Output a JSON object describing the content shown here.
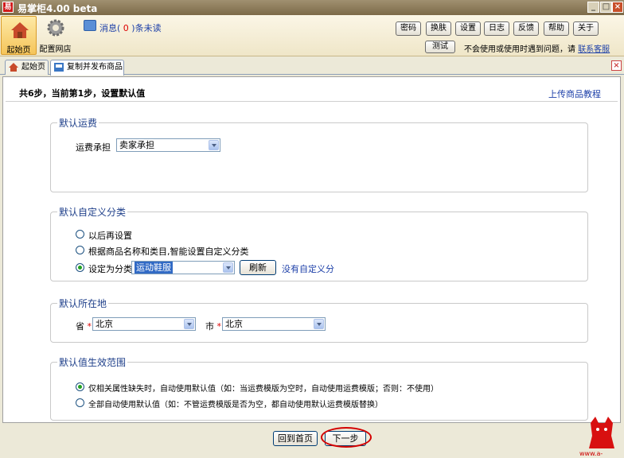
{
  "window": {
    "title": "易掌柜4.00 beta",
    "app_icon": "易"
  },
  "toolbar": {
    "home_label": "起始页",
    "shop_label": "配置网店",
    "message_prefix": "消息(",
    "message_count": "0",
    "message_suffix": ")条未读",
    "buttons": [
      "密码",
      "换肤",
      "设置",
      "日志",
      "反馈",
      "帮助",
      "关于"
    ],
    "test_button": "测试",
    "trouble_text": "不会使用或使用时遇到问题，请",
    "contact_link": "联系客服"
  },
  "tabs": [
    {
      "label": "起始页"
    },
    {
      "label": "复制并发布商品"
    }
  ],
  "main": {
    "step_title": "共6步，当前第1步，设置默认值",
    "tutorial_link": "上传商品教程",
    "shipping": {
      "legend": "默认运费",
      "label": "运费承担",
      "value": "卖家承担"
    },
    "category": {
      "legend": "默认自定义分类",
      "option1": "以后再设置",
      "option2": "根据商品名称和类目,智能设置自定义分类",
      "option3": "设定为分类",
      "selected_category": "运动鞋服",
      "refresh_button": "刷新",
      "no_category_link": "没有自定义分"
    },
    "location": {
      "legend": "默认所在地",
      "province_label": "省",
      "province_value": "北京",
      "city_label": "市",
      "city_value": "北京",
      "required_mark": "*"
    },
    "scope": {
      "legend": "默认值生效范围",
      "option1": "仅相关属性缺失时，自动使用默认值（如：当运费模版为空时，自动使用运费模版；否则：不使用）",
      "option2": "全部自动使用默认值（如：不管运费模版是否为空，都自动使用默认运费模版替换）"
    }
  },
  "footer": {
    "back_button": "回到首页",
    "next_button": "下一步",
    "watermark": "www.a-i.com.cn"
  },
  "colors": {
    "accent": "#1c3fa8",
    "legend": "#1e3f8a",
    "highlight": "#d40000"
  }
}
